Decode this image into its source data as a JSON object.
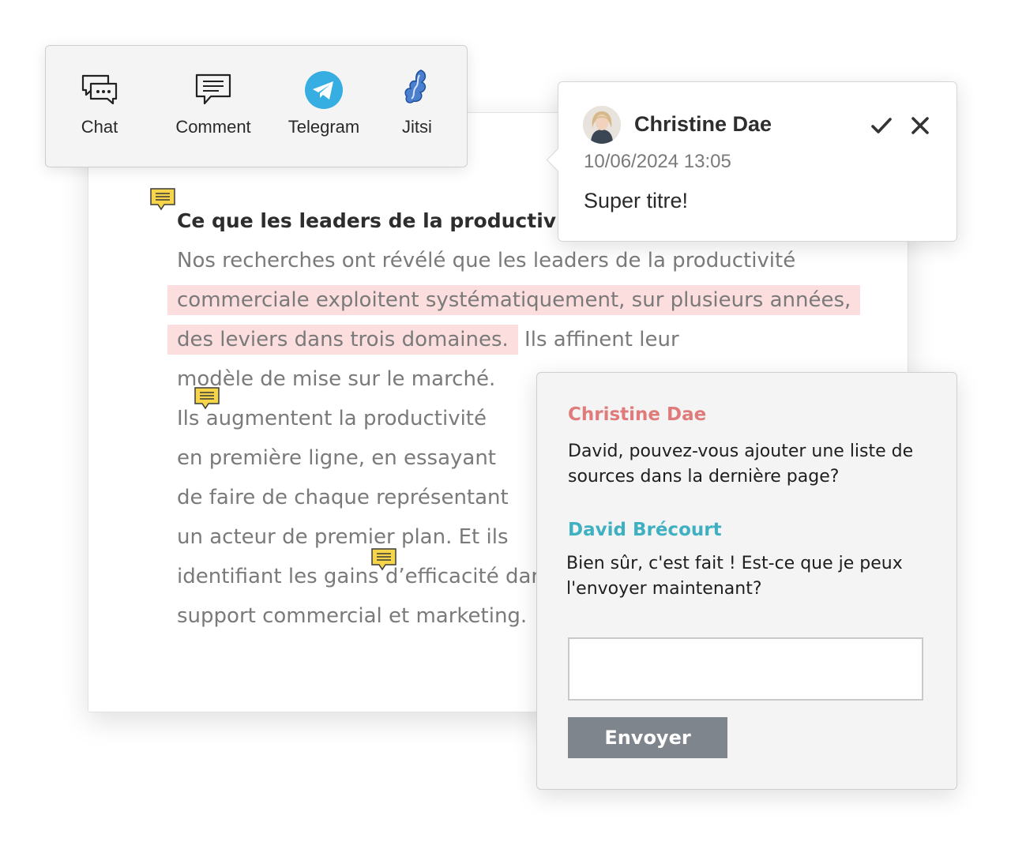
{
  "toolbar": {
    "items": [
      {
        "label": "Chat",
        "icon": "chat-bubbles-icon"
      },
      {
        "label": "Comment",
        "icon": "comment-icon"
      },
      {
        "label": "Telegram",
        "icon": "telegram-icon"
      },
      {
        "label": "Jitsi",
        "icon": "jitsi-icon"
      }
    ]
  },
  "document": {
    "title": "Ce que les leaders de la productivit",
    "lines": [
      "Nos recherches ont révélé que les leaders de la productivité",
      "commerciale exploitent systématiquement, sur plusieurs années,",
      "des leviers dans trois domaines.",
      " Ils affinent leur",
      "modèle de mise sur le marché.",
      "Ils augmentent la productivité",
      "en première ligne, en essayant",
      "de faire de chaque représentant",
      "un acteur de premier plan. Et ils",
      "identifiant les gains d’efficacité dan",
      "support commercial et marketing."
    ],
    "highlight_color": "#fbdedd",
    "note_icon": "comment-note-icon",
    "note_color": "#f7d54a"
  },
  "comment_popup": {
    "author": "Christine Dae",
    "date": "10/06/2024 13:05",
    "text": "Super titre!",
    "accept_icon": "checkmark-icon",
    "close_icon": "close-icon"
  },
  "chat": {
    "messages": [
      {
        "author": "Christine Dae",
        "color": "#e07b7b",
        "text": "David, pouvez-vous ajouter une liste de sources dans la dernière page?"
      },
      {
        "author": "David Brécourt",
        "color": "#3fb0c1",
        "text": "Bien sûr, c'est fait ! Est-ce que je peux l'envoyer maintenant?"
      }
    ],
    "input_value": "",
    "send_label": "Envoyer"
  }
}
